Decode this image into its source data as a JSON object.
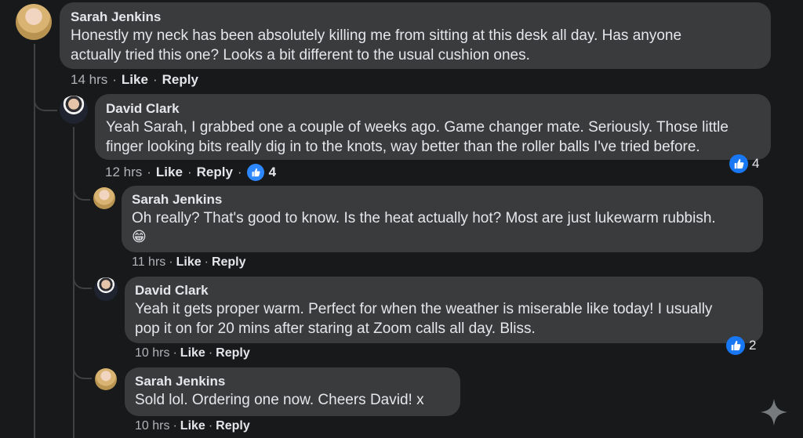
{
  "comments": [
    {
      "name": "Sarah Jenkins",
      "text_lines": [
        "Honestly my neck has been absolutely killing me from sitting at this desk all day. Has anyone",
        "actually tried this one? Looks a bit different to the usual cushion ones."
      ],
      "time": "14 hrs",
      "like": "Like",
      "reply": "Reply"
    },
    {
      "name": "David Clark",
      "text_lines": [
        "Yeah Sarah, I grabbed one a couple of weeks ago. Game changer mate. Seriously. Those little",
        "finger looking bits really dig in to the knots, way better than the roller balls I've tried before."
      ],
      "time": "12 hrs",
      "like": "Like",
      "reply": "Reply",
      "reaction_count": "4",
      "meta_count": "4"
    },
    {
      "name": "Sarah Jenkins",
      "text_lines": [
        "Oh really? That's good to know. Is the heat actually hot? Most are just lukewarm rubbish."
      ],
      "emoji": "😁",
      "time": "11 hrs",
      "like": "Like",
      "reply": "Reply"
    },
    {
      "name": "David Clark",
      "text_lines": [
        "Yeah it gets proper warm. Perfect for when the weather is miserable like today! I usually",
        "pop it on for 20 mins after staring at Zoom calls all day. Bliss."
      ],
      "time": "10 hrs",
      "like": "Like",
      "reply": "Reply",
      "reaction_count": "2"
    },
    {
      "name": "Sarah Jenkins",
      "text_lines": [
        "Sold lol. Ordering one now. Cheers David! x"
      ],
      "time": "10 hrs",
      "like": "Like",
      "reply": "Reply"
    }
  ],
  "separator": "·",
  "colors": {
    "background": "#18191a",
    "bubble": "#3a3b3c",
    "like_blue": "#1877f2"
  }
}
